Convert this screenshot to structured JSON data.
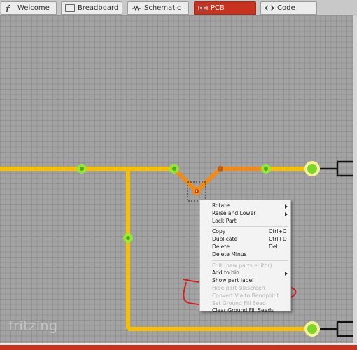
{
  "tabs": [
    {
      "label": "Welcome",
      "active": false,
      "icon": "fritzing-icon"
    },
    {
      "label": "Breadboard",
      "active": false,
      "icon": "breadboard-icon"
    },
    {
      "label": "Schematic",
      "active": false,
      "icon": "schematic-icon"
    },
    {
      "label": "PCB",
      "active": true,
      "icon": "pcb-icon"
    },
    {
      "label": "Code",
      "active": false,
      "icon": "code-icon"
    }
  ],
  "logo": "fritzing",
  "context_menu": {
    "items": [
      {
        "label": "Rotate",
        "submenu": true
      },
      {
        "label": "Raise and Lower",
        "submenu": true
      },
      {
        "label": "Lock Part"
      },
      {
        "label": "Copy",
        "shortcut": "Ctrl+C"
      },
      {
        "label": "Duplicate",
        "shortcut": "Ctrl+D"
      },
      {
        "label": "Delete",
        "shortcut": "Del"
      },
      {
        "label": "Delete Minus"
      },
      {
        "label": "Edit (new parts editor)",
        "disabled": true
      },
      {
        "label": "Add to bin...",
        "submenu": true
      },
      {
        "label": "Show part label"
      },
      {
        "label": "Hide part silkscreen",
        "disabled": true
      },
      {
        "label": "Convert Via to Bendpoint",
        "disabled": true
      },
      {
        "label": "Set Ground Fill Seed",
        "disabled": true
      },
      {
        "label": "Clear Ground Fill Seeds"
      }
    ]
  },
  "colors": {
    "trace": "#f6c000",
    "selected_trace": "#f28b16",
    "via_ring": "#90ee30",
    "annotation": "#d42020",
    "active_tab": "#c8331f",
    "canvas": "#a3a3a3"
  }
}
